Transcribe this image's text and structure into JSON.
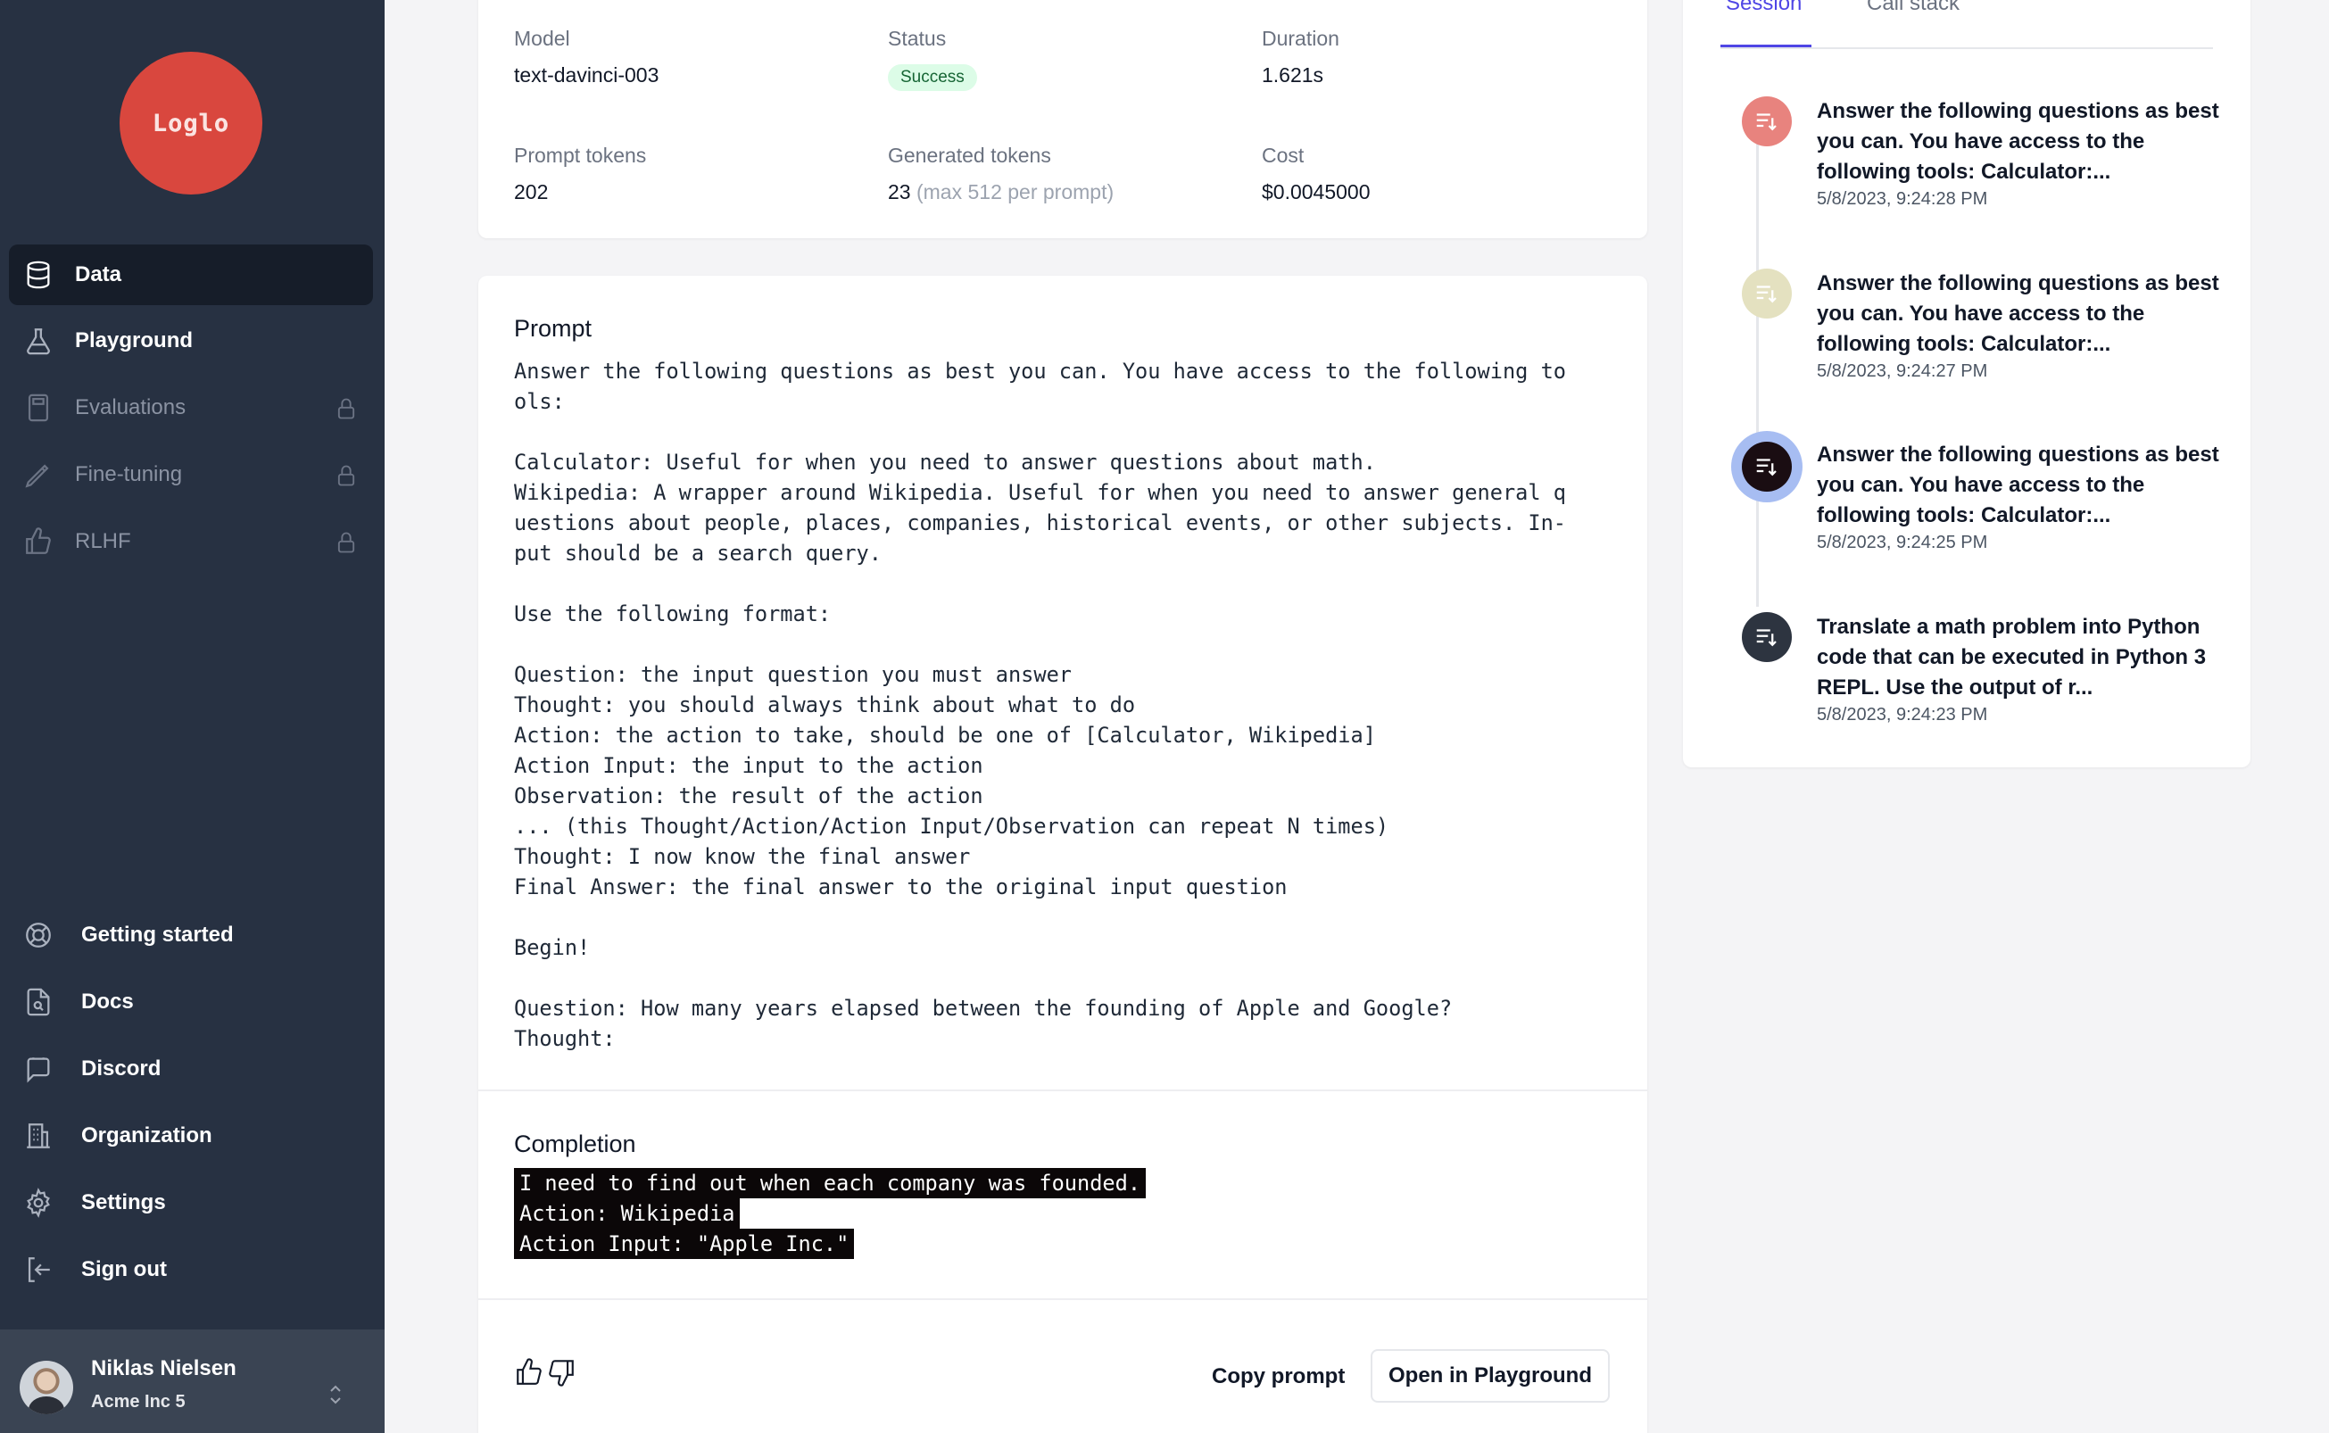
{
  "sidebar": {
    "logo_text": "Loglo",
    "nav": [
      {
        "label": "Data",
        "icon": "database-icon",
        "active": true,
        "locked": false
      },
      {
        "label": "Playground",
        "icon": "flask-icon",
        "active": false,
        "locked": false
      },
      {
        "label": "Evaluations",
        "icon": "calculator-icon",
        "active": false,
        "locked": true
      },
      {
        "label": "Fine-tuning",
        "icon": "pencil-icon",
        "active": false,
        "locked": true
      },
      {
        "label": "RLHF",
        "icon": "thumbs-up-icon",
        "active": false,
        "locked": true
      }
    ],
    "bottom": [
      {
        "label": "Getting started",
        "icon": "lifebuoy-icon"
      },
      {
        "label": "Docs",
        "icon": "document-search-icon"
      },
      {
        "label": "Discord",
        "icon": "chat-bubbles-icon"
      },
      {
        "label": "Organization",
        "icon": "building-icon"
      },
      {
        "label": "Settings",
        "icon": "gear-icon"
      },
      {
        "label": "Sign out",
        "icon": "sign-out-icon"
      }
    ],
    "user": {
      "name": "Niklas Nielsen",
      "org": "Acme Inc 5"
    }
  },
  "meta": {
    "model_label": "Model",
    "model_value": "text-davinci-003",
    "status_label": "Status",
    "status_value": "Success",
    "duration_label": "Duration",
    "duration_value": "1.621s",
    "prompt_tokens_label": "Prompt tokens",
    "prompt_tokens_value": "202",
    "generated_tokens_label": "Generated tokens",
    "generated_tokens_value": "23",
    "generated_tokens_note": "(max 512 per prompt)",
    "cost_label": "Cost",
    "cost_value": "$0.0045000"
  },
  "prompt": {
    "title": "Prompt",
    "text": "Answer the following questions as best you can. You have access to the following to\nols:\n\nCalculator: Useful for when you need to answer questions about math.\nWikipedia: A wrapper around Wikipedia. Useful for when you need to answer general q\nuestions about people, places, companies, historical events, or other subjects. In-\nput should be a search query.\n\nUse the following format:\n\nQuestion: the input question you must answer\nThought: you should always think about what to do\nAction: the action to take, should be one of [Calculator, Wikipedia]\nAction Input: the input to the action\nObservation: the result of the action\n... (this Thought/Action/Action Input/Observation can repeat N times)\nThought: I now know the final answer\nFinal Answer: the final answer to the original input question\n\nBegin!\n\nQuestion: How many years elapsed between the founding of Apple and Google?\nThought:"
  },
  "completion": {
    "title": "Completion",
    "lines": [
      "I need to find out when each company was founded.",
      "Action: Wikipedia",
      "Action Input: \"Apple Inc.\""
    ]
  },
  "actions": {
    "copy_label": "Copy prompt",
    "open_label": "Open in Playground"
  },
  "session": {
    "tabs": [
      "Session",
      "Call stack"
    ],
    "items": [
      {
        "text": "Answer the following questions as best you can. You have access to the following tools: Calculator:...",
        "time": "5/8/2023, 9:24:28 PM",
        "color": "#e8837e"
      },
      {
        "text": "Answer the following questions as best you can. You have access to the following tools: Calculator:...",
        "time": "5/8/2023, 9:24:27 PM",
        "color": "#e4e1c0"
      },
      {
        "text": "Answer the following questions as best you can. You have access to the following tools: Calculator:...",
        "time": "5/8/2023, 9:24:25 PM",
        "color": "#1a0d12"
      },
      {
        "text": "Translate a math problem into Python code that can be executed in Python 3 REPL. Use the output of r...",
        "time": "5/8/2023, 9:24:23 PM",
        "color": "#2d3440"
      }
    ]
  }
}
